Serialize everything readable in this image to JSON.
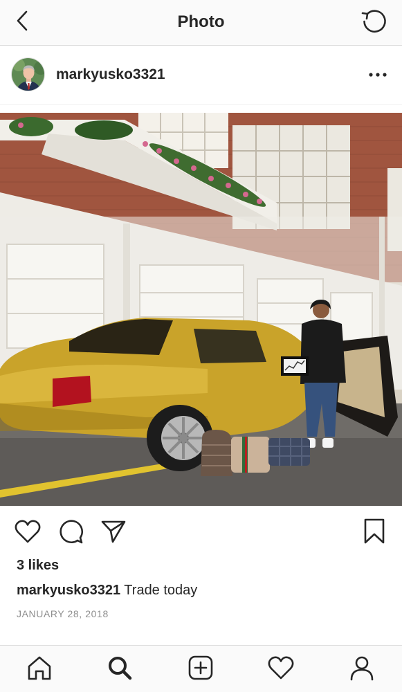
{
  "header": {
    "title": "Photo",
    "back_icon": "chevron-left-icon",
    "refresh_icon": "refresh-icon"
  },
  "post": {
    "username": "markyusko3321",
    "more_icon": "more-horizontal-icon",
    "likes": "3 likes",
    "caption_user": "markyusko3321",
    "caption_text": " Trade today",
    "date": "JANUARY 28, 2018"
  },
  "actions": [
    "heart-icon",
    "comment-icon",
    "share-icon",
    "bookmark-icon"
  ],
  "tabbar": [
    "home-icon",
    "search-icon",
    "new-post-icon",
    "activity-heart-icon",
    "profile-icon"
  ],
  "colors": {
    "text": "#262626",
    "secondary": "#8e8e8e",
    "border": "#dbdbdb",
    "bar_bg": "#fafafa",
    "car_gold": "#c9a32a"
  }
}
